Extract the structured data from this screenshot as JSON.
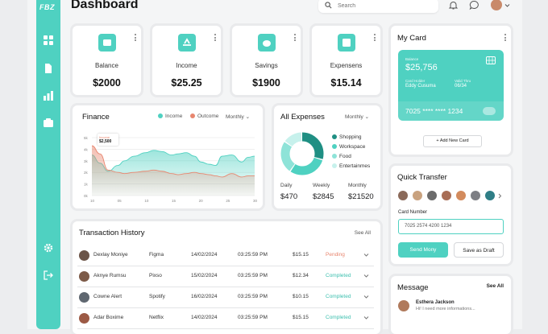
{
  "app": {
    "logo": "FBZ",
    "title": "Dashboard"
  },
  "search": {
    "placeholder": "Search"
  },
  "stats": [
    {
      "label": "Balance",
      "value": "$2000"
    },
    {
      "label": "Income",
      "value": "$25.25"
    },
    {
      "label": "Savings",
      "value": "$1900"
    },
    {
      "label": "Expensens",
      "value": "$15.14"
    }
  ],
  "finance": {
    "title": "Finance",
    "legend_income": "Income",
    "legend_outcome": "Outcome",
    "period": "Monthly",
    "tooltip_label": "Income",
    "tooltip_value": "$2,500",
    "colors": {
      "income": "#4fd1c1",
      "outcome": "#e8866f"
    }
  },
  "chart_data": {
    "type": "area",
    "x_ticks": [
      "10",
      "05",
      "10",
      "15",
      "20",
      "25",
      "30"
    ],
    "y_ticks": [
      "5k",
      "4k",
      "3k",
      "2k",
      "1k",
      "0k"
    ],
    "ylim": [
      0,
      5
    ],
    "x": [
      0,
      0.05,
      0.1,
      0.16,
      0.2,
      0.26,
      0.33,
      0.38,
      0.43,
      0.49,
      0.53,
      0.58,
      0.63,
      0.67,
      0.72,
      0.76,
      0.8,
      0.86,
      0.92,
      0.96,
      1
    ],
    "series": [
      {
        "name": "Income",
        "values": [
          3.5,
          2.8,
          2.1,
          2.6,
          3.0,
          3.4,
          3.7,
          3.9,
          3.8,
          3.5,
          3.6,
          3.7,
          3.4,
          2.9,
          2.7,
          2.6,
          3.4,
          3.5,
          2.9,
          3.3,
          3.4
        ]
      },
      {
        "name": "Outcome",
        "values": [
          4.3,
          3.6,
          2.2,
          2.0,
          1.9,
          2.0,
          2.1,
          2.2,
          2.1,
          1.9,
          1.8,
          1.9,
          2.0,
          1.9,
          1.8,
          1.7,
          1.6,
          1.9,
          1.6,
          1.7,
          1.7
        ]
      }
    ]
  },
  "expenses": {
    "title": "All Expenses",
    "period": "Monthly",
    "legend": [
      "Shopping",
      "Workspace",
      "Food",
      "Entertainmes"
    ],
    "colors": [
      "#1f8f83",
      "#4fd1c1",
      "#8ee3d8",
      "#c7f1ec"
    ],
    "shares": [
      0.3,
      0.3,
      0.25,
      0.15
    ],
    "summary": [
      {
        "label": "Daily",
        "value": "$470"
      },
      {
        "label": "Weekly",
        "value": "$2845"
      },
      {
        "label": "Monthly",
        "value": "$21520"
      }
    ]
  },
  "transactions": {
    "title": "Transaction History",
    "see_all": "See All",
    "rows": [
      {
        "name": "Dexlay Moniye",
        "app": "Figma",
        "date": "14/02/2024",
        "time": "03:25:59 PM",
        "amount": "$15.15",
        "status": "Pending"
      },
      {
        "name": "Aknye Rumsu",
        "app": "Pixso",
        "date": "15/02/2024",
        "time": "03:25:59 PM",
        "amount": "$12.34",
        "status": "Completed"
      },
      {
        "name": "Cowne Alert",
        "app": "Spotify",
        "date": "16/02/2024",
        "time": "03:25:59 PM",
        "amount": "$10.15",
        "status": "Completed"
      },
      {
        "name": "Adar Boxime",
        "app": "Netflix",
        "date": "14/02/2024",
        "time": "03:25:59 PM",
        "amount": "$15.15",
        "status": "Completed"
      }
    ]
  },
  "my_card": {
    "title": "My Card",
    "balance_label": "Balance",
    "balance": "$25,756",
    "holder_label": "Card Holder",
    "holder": "Eddy Cusuma",
    "valid_label": "Valid Thru",
    "valid": "06/34",
    "number": "7025 **** **** 1234",
    "add_button": "Add New Card"
  },
  "quick_transfer": {
    "title": "Quick Transfer",
    "card_number_label": "Card Number",
    "card_number": "7025 2574 4200 1234",
    "send_button": "Send Mony",
    "draft_button": "Save as Draft"
  },
  "message": {
    "title": "Message",
    "see_all": "See All",
    "sender": "Esthera Jackson",
    "preview": "Hi! I need more informations..."
  }
}
